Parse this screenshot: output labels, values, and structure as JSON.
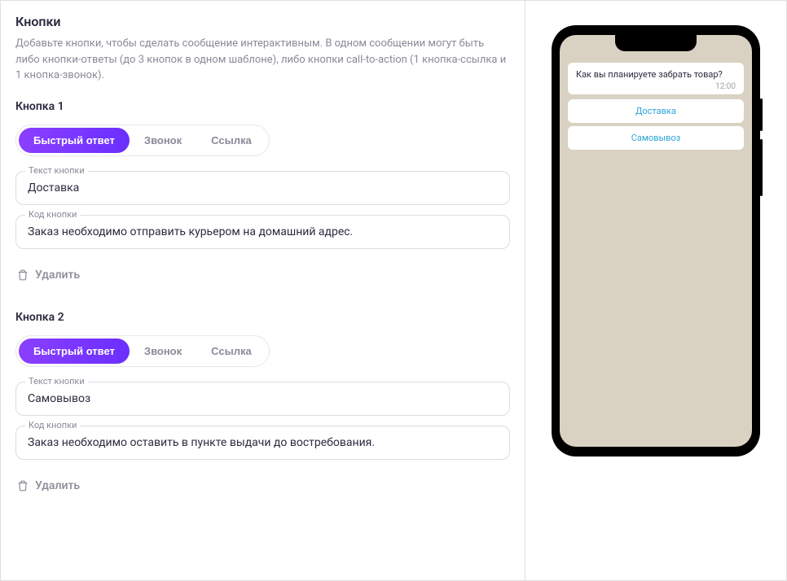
{
  "section": {
    "title": "Кнопки",
    "description": "Добавьте кнопки, чтобы сделать сообщение интерактивным. В одном сообщении могут быть либо кнопки-ответы (до 3 кнопок в одном шаблоне), либо кнопки call-to-action (1 кнопка-ссылка и 1 кнопка-звонок)."
  },
  "segments": {
    "quick_reply": "Быстрый ответ",
    "call": "Звонок",
    "link": "Ссылка"
  },
  "labels": {
    "button_text": "Текст кнопки",
    "button_code": "Код кнопки",
    "delete": "Удалить"
  },
  "buttons": [
    {
      "title": "Кнопка 1",
      "active_segment": "quick_reply",
      "text_value": "Доставка",
      "code_value": "Заказ необходимо отправить курьером на домашний адрес."
    },
    {
      "title": "Кнопка 2",
      "active_segment": "quick_reply",
      "text_value": "Самовывоз",
      "code_value": "Заказ необходимо оставить в пункте выдачи до востребования."
    }
  ],
  "preview": {
    "message_text": "Как вы планируете забрать товар?",
    "message_time": "12:00",
    "buttons": [
      "Доставка",
      "Самовывоз"
    ]
  }
}
